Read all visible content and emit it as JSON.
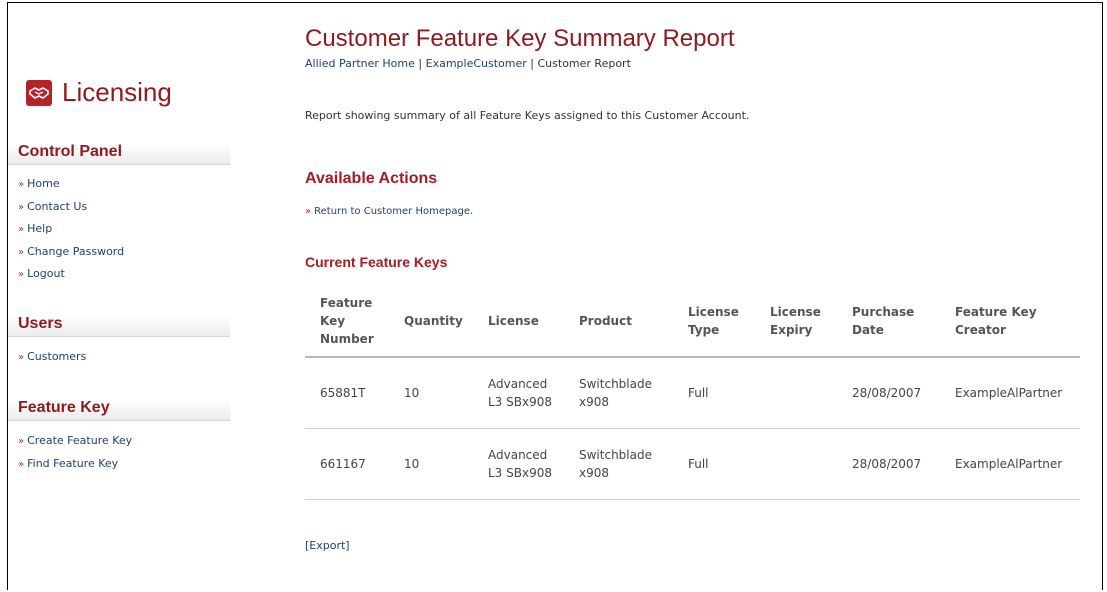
{
  "brand": {
    "name": "Licensing",
    "icon": "handshake-icon",
    "color": "#b5222a"
  },
  "sidebar": {
    "sections": [
      {
        "title": "Control Panel",
        "items": [
          "Home",
          "Contact Us",
          "Help",
          "Change Password",
          "Logout"
        ]
      },
      {
        "title": "Users",
        "items": [
          "Customers"
        ]
      },
      {
        "title": "Feature Key",
        "items": [
          "Create Feature Key",
          "Find Feature Key"
        ]
      }
    ]
  },
  "page": {
    "title": "Customer Feature Key Summary Report",
    "breadcrumb": {
      "home": "Allied Partner Home",
      "sep": "|",
      "customer": "ExampleCustomer",
      "current": "Customer Report"
    },
    "intro": "Report showing summary of all Feature Keys assigned to this Customer Account.",
    "actions_heading": "Available Actions",
    "actions": [
      "Return to Customer Homepage."
    ],
    "keys_heading": "Current Feature Keys",
    "export": "[Export]"
  },
  "table": {
    "headers": [
      "Feature Key Number",
      "Quantity",
      "License",
      "Product",
      "License Type",
      "License Expiry",
      "Purchase Date",
      "Feature Key Creator"
    ],
    "rows": [
      [
        "65881T",
        "10",
        "Advanced L3 SBx908",
        "Switchblade x908",
        "Full",
        "",
        "28/08/2007",
        "ExampleAlPartner"
      ],
      [
        "661167",
        "10",
        "Advanced L3 SBx908",
        "Switchblade x908",
        "Full",
        "",
        "28/08/2007",
        "ExampleAlPartner"
      ]
    ]
  }
}
